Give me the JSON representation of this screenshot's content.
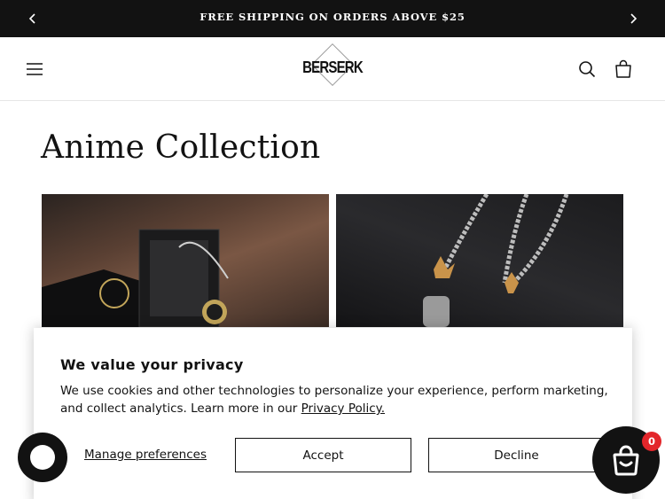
{
  "announcement": {
    "message": "FREE SHIPPING ON ORDERS ABOVE $25",
    "prev_icon": "chevron-left-icon",
    "next_icon": "chevron-right-icon"
  },
  "header": {
    "logo_text": "BERSERK",
    "menu_icon": "hamburger-menu-icon",
    "search_icon": "search-icon",
    "cart_icon": "cart-icon"
  },
  "main": {
    "title": "Anime Collection",
    "cards": [
      {
        "image": "one-piece-necklace-in-display-box"
      },
      {
        "image": "silver-chain-pendants-on-dark-background"
      }
    ]
  },
  "privacy": {
    "heading": "We value your privacy",
    "body_text": "We use cookies and other technologies to personalize your experience, perform marketing, and collect analytics. Learn more in our ",
    "policy_link": "Privacy Policy.",
    "manage_label": "Manage preferences",
    "accept_label": "Accept",
    "decline_label": "Decline"
  },
  "floating": {
    "chat_icon": "chat-bubble-icon",
    "cart_icon": "shopping-bag-icon",
    "cart_count": "0"
  },
  "colors": {
    "dark": "#121212",
    "badge": "#e3262b",
    "background": "#ffffff"
  }
}
